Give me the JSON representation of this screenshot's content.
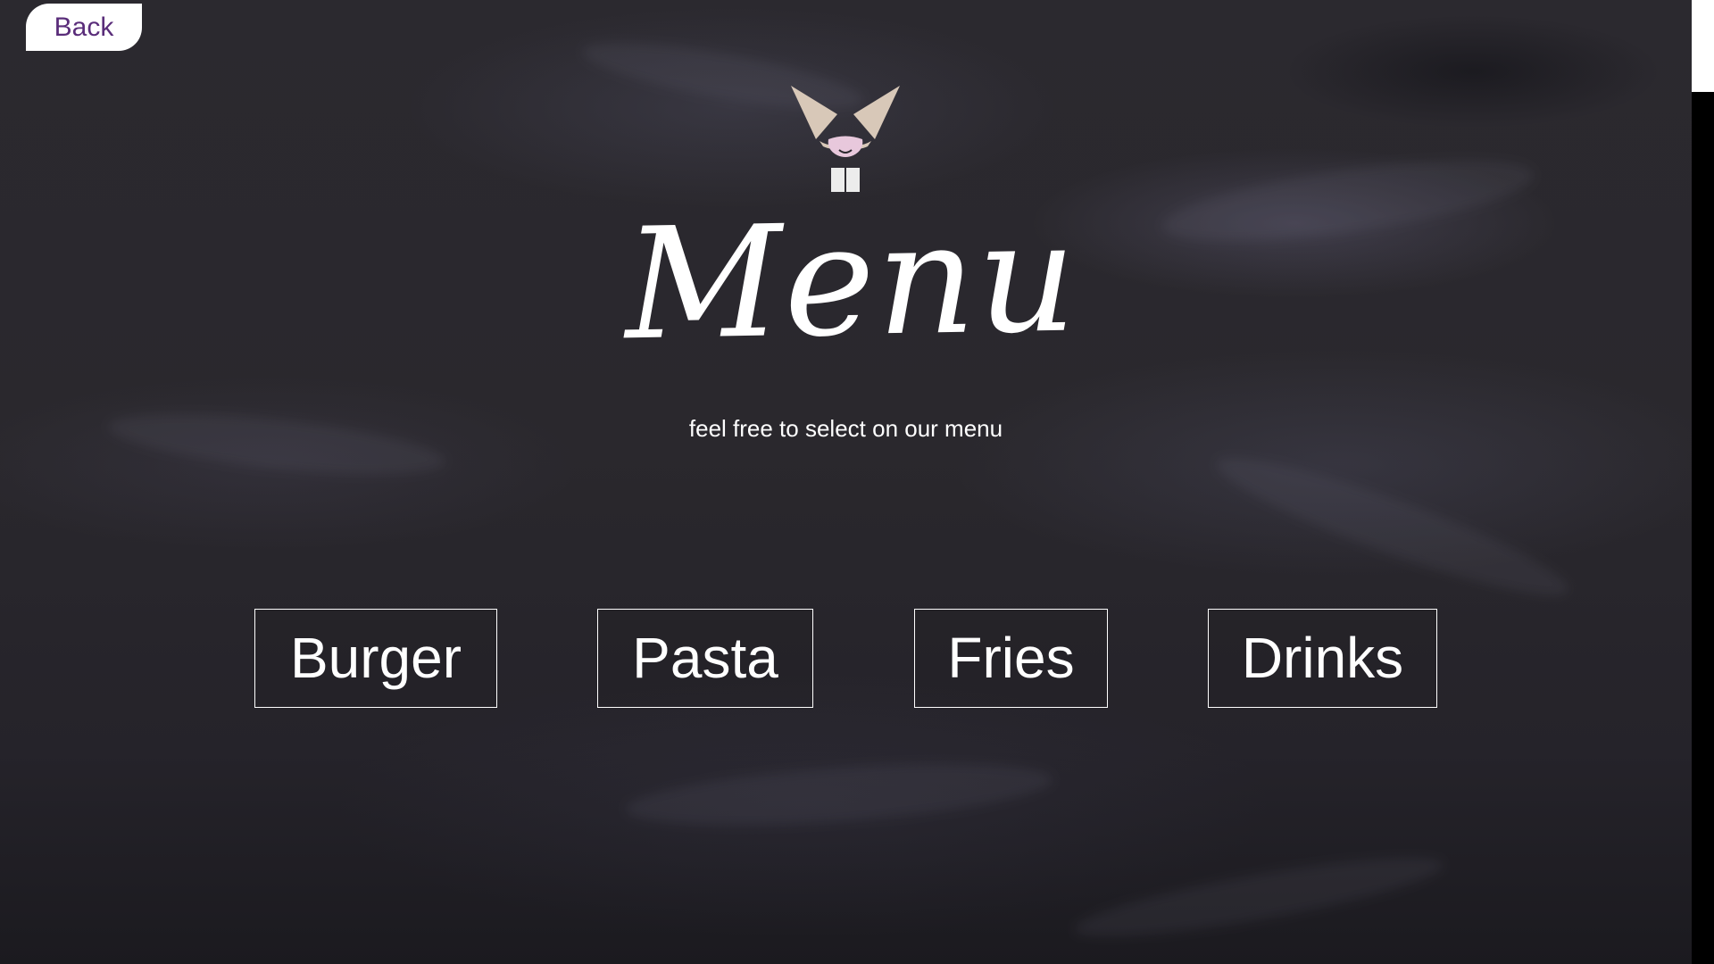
{
  "header": {
    "back_label": "Back"
  },
  "hero": {
    "logo_icon": "cat-face-logo-icon",
    "title": "Menu",
    "subtitle": "feel free to select on our menu"
  },
  "categories": [
    {
      "label": "Burger"
    },
    {
      "label": "Pasta"
    },
    {
      "label": "Fries"
    },
    {
      "label": "Drinks"
    }
  ],
  "colors": {
    "chalkboard": "#2a282d",
    "text": "#ffffff",
    "back_text": "#5a2d7a",
    "logo_ears": "#d8c8b8",
    "logo_nose": "#e8c8dc"
  }
}
